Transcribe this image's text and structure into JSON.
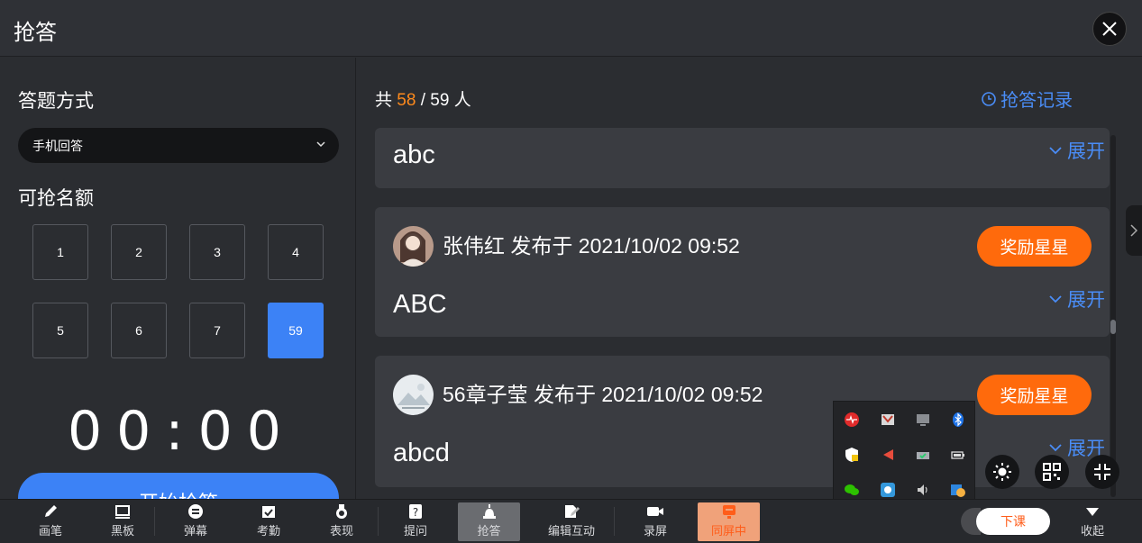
{
  "header": {
    "title": "抢答"
  },
  "left": {
    "mode_label": "答题方式",
    "mode_value": "手机回答",
    "quota_label": "可抢名额",
    "quota_options": [
      "1",
      "2",
      "3",
      "4",
      "5",
      "6",
      "7",
      "59"
    ],
    "quota_selected": "59",
    "timer": "00:00",
    "start_label": "开始抢答"
  },
  "right": {
    "count_prefix": "共",
    "count_answered": "58",
    "count_suffix": "/ 59 人",
    "history_label": "抢答记录",
    "expand_label": "展开",
    "reward_label": "奖励星星",
    "cards": [
      {
        "content": "abc"
      },
      {
        "author": "张伟红 发布于 2021/10/02 09:52",
        "content": "ABC"
      },
      {
        "author": "56章子莹 发布于 2021/10/02 09:52",
        "content": "abcd"
      }
    ]
  },
  "toolbar": {
    "items": [
      "画笔",
      "黑板",
      "弹幕",
      "考勤",
      "表现",
      "提问",
      "抢答",
      "编辑互动",
      "录屏",
      "同屏中"
    ],
    "dismiss_label": "下课",
    "collapse_label": "收起"
  },
  "colors": {
    "accent_blue": "#3c82f6",
    "accent_orange": "#ff6a0c",
    "count_orange": "#ff8a1c"
  }
}
